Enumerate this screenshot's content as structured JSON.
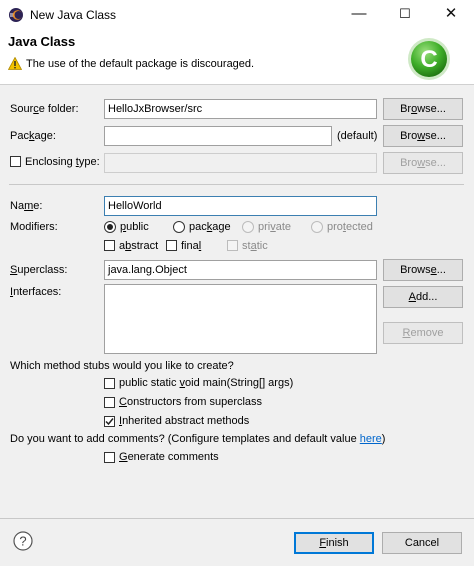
{
  "window": {
    "title": "New Java Class",
    "controls": {
      "minimize": "—",
      "maximize": "☐",
      "close": "✕"
    }
  },
  "header": {
    "title": "Java Class",
    "message": "The use of the default package is discouraged.",
    "logo_letter": "C"
  },
  "form": {
    "source_folder": {
      "label_pre": "Sour",
      "label_u": "c",
      "label_post": "e folder:",
      "value": "HelloJxBrowser/src",
      "button_pre": "Br",
      "button_u": "o",
      "button_post": "wse..."
    },
    "package": {
      "label_pre": "Pac",
      "label_u": "k",
      "label_post": "age:",
      "value": "",
      "suffix": "(default)",
      "button_pre": "Bro",
      "button_u": "w",
      "button_post": "se..."
    },
    "enclosing_type": {
      "label_pre": "Enclosing ",
      "label_u": "t",
      "label_post": "ype:",
      "checked": false,
      "value": "",
      "button_pre": "Bro",
      "button_u": "w",
      "button_post": "se..."
    },
    "name": {
      "label_pre": "Na",
      "label_u": "m",
      "label_post": "e:",
      "value": "HelloWorld"
    },
    "modifiers": {
      "label": "Modifiers:",
      "public": {
        "pre": "",
        "u": "p",
        "post": "ublic",
        "selected": true
      },
      "package": {
        "pre": "pac",
        "u": "k",
        "post": "age",
        "selected": false
      },
      "private": {
        "pre": "pri",
        "u": "v",
        "post": "ate",
        "selected": false,
        "enabled": false
      },
      "protected": {
        "pre": "pro",
        "u": "t",
        "post": "ected",
        "selected": false,
        "enabled": false
      },
      "abstract": {
        "pre": "a",
        "u": "b",
        "post": "stract",
        "checked": false
      },
      "final": {
        "pre": "fina",
        "u": "l",
        "post": "",
        "checked": false
      },
      "static": {
        "pre": "st",
        "u": "a",
        "post": "tic",
        "checked": false,
        "enabled": false
      }
    },
    "superclass": {
      "label_pre": "",
      "label_u": "S",
      "label_post": "uperclass:",
      "value": "java.lang.Object",
      "button_pre": "Brows",
      "button_u": "e",
      "button_post": "..."
    },
    "interfaces": {
      "label_pre": "",
      "label_u": "I",
      "label_post": "nterfaces:",
      "add_pre": "",
      "add_u": "A",
      "add_post": "dd...",
      "remove_pre": "",
      "remove_u": "R",
      "remove_post": "emove"
    }
  },
  "stubs": {
    "question": "Which method stubs would you like to create?",
    "main": {
      "pre": "public static ",
      "u": "v",
      "post": "oid main(String[] args)",
      "checked": false
    },
    "constructors": {
      "pre": "",
      "u": "C",
      "post": "onstructors from superclass",
      "checked": false
    },
    "inherited": {
      "pre": "",
      "u": "I",
      "post": "nherited abstract methods",
      "checked": true
    }
  },
  "comments": {
    "question": "Do you want to add comments? (Configure templates and default value ",
    "link": "here",
    "question_end": ")",
    "generate": {
      "pre": "",
      "u": "G",
      "post": "enerate comments",
      "checked": false
    }
  },
  "footer": {
    "help_glyph": "?",
    "finish_pre": "",
    "finish_u": "F",
    "finish_post": "inish",
    "cancel": "Cancel"
  },
  "colors": {
    "link": "#0066cc",
    "default_button_border": "#0078d7",
    "logo_green": "#3fae29",
    "warning": "#f2c200"
  }
}
